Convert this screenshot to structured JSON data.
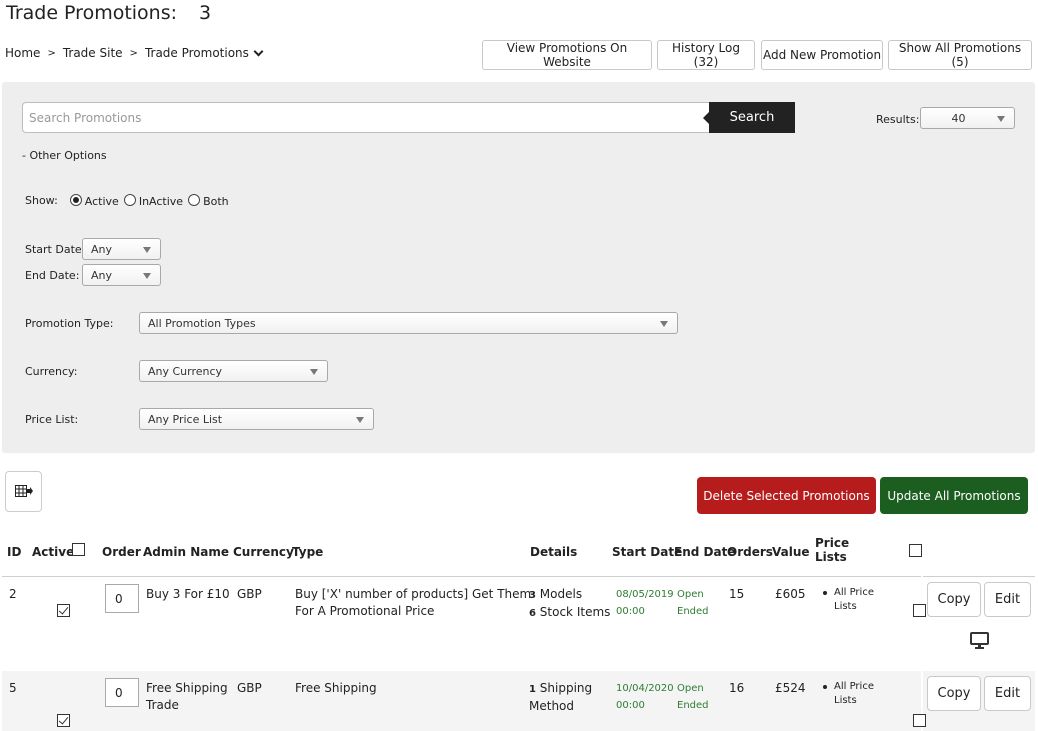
{
  "header": {
    "title": "Trade Promotions:",
    "count": "3"
  },
  "breadcrumb": {
    "items": [
      "Home",
      "Trade Site",
      "Trade Promotions"
    ],
    "separator": ">"
  },
  "toolbar": {
    "view_on_website": "View Promotions On Website",
    "history_log": "History Log (32)",
    "add_new": "Add New Promotion",
    "show_all": "Show All Promotions (5)"
  },
  "search": {
    "placeholder": "Search Promotions",
    "value": "",
    "button_label": "Search",
    "results_label": "Results:",
    "results_value": "40"
  },
  "filters": {
    "other_options_label": "- Other Options",
    "show_label": "Show:",
    "show_options": [
      {
        "label": "Active",
        "selected": true
      },
      {
        "label": "InActive",
        "selected": false
      },
      {
        "label": "Both",
        "selected": false
      }
    ],
    "start_date_label": "Start Date:",
    "start_date_value": "Any",
    "end_date_label": "End Date:",
    "end_date_value": "Any",
    "promotion_type_label": "Promotion Type:",
    "promotion_type_value": "All Promotion Types",
    "currency_label": "Currency:",
    "currency_value": "Any Currency",
    "price_list_label": "Price List:",
    "price_list_value": "Any Price List"
  },
  "actions": {
    "delete_selected": "Delete Selected Promotions",
    "update_all": "Update All Promotions",
    "delete_color": "#b71c1c",
    "update_color": "#1b5e20"
  },
  "table": {
    "columns": {
      "id": "ID",
      "active": "Active",
      "order": "Order",
      "admin_name": "Admin Name",
      "currency": "Currency",
      "type": "Type",
      "details": "Details",
      "start_date": "Start Date",
      "end_date": "End Date",
      "orders": "Orders",
      "value": "Value",
      "price_lists_line1": "Price",
      "price_lists_line2": "Lists"
    },
    "rows": [
      {
        "id": "2",
        "active": true,
        "order": "0",
        "admin_name": "Buy 3 For £10",
        "currency": "GBP",
        "type_line1": "Buy ['X' number of products] Get Them",
        "type_line2": "For A Promotional Price",
        "details_line1_count": "3",
        "details_line1_text": "Models",
        "details_line2_count": "6",
        "details_line2_text": "Stock Items",
        "start_date": "08/05/2019",
        "start_time": "00:00",
        "end_line1": "Open",
        "end_line2": "Ended",
        "orders": "15",
        "value": "£605",
        "price_list_line1": "All Price",
        "price_list_line2": "Lists",
        "selected": false,
        "copy_label": "Copy",
        "edit_label": "Edit"
      },
      {
        "id": "5",
        "active": true,
        "order": "0",
        "admin_name_line1": "Free Shipping",
        "admin_name_line2": "Trade",
        "currency": "GBP",
        "type_line1": "Free Shipping",
        "details_line1_count": "1",
        "details_line1_text": "Shipping",
        "details_line2_text": "Method",
        "start_date": "10/04/2020",
        "start_time": "00:00",
        "end_line1": "Open",
        "end_line2": "Ended",
        "orders": "16",
        "value": "£524",
        "price_list_line1": "All Price",
        "price_list_line2": "Lists",
        "selected": false,
        "copy_label": "Copy",
        "edit_label": "Edit"
      }
    ]
  }
}
